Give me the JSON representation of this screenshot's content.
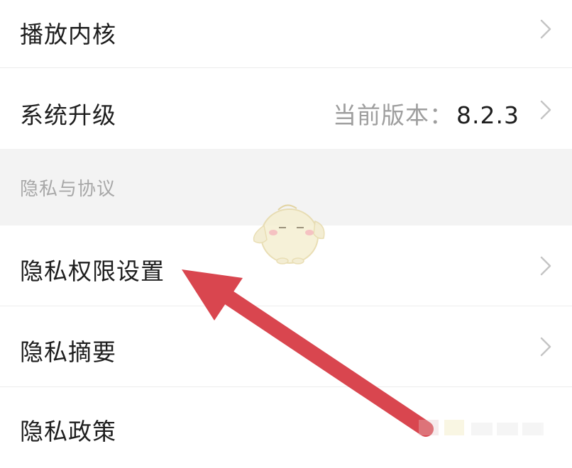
{
  "settings": {
    "rows_top": [
      {
        "label": "播放内核"
      },
      {
        "label": "系统升级",
        "value_prefix": "当前版本：",
        "value": "8.2.3"
      }
    ],
    "section_title": "隐私与协议",
    "rows_privacy": [
      {
        "label": "隐私权限设置"
      },
      {
        "label": "隐私摘要"
      },
      {
        "label": "隐私政策"
      }
    ]
  },
  "icons": {
    "chevron": "chevron-right-icon",
    "mascot": "duck-mascot-sticker",
    "arrow": "annotation-arrow"
  },
  "colors": {
    "arrow": "#d9464f",
    "section_bg": "#f3f3f3",
    "chevron": "#c4c4c4"
  }
}
